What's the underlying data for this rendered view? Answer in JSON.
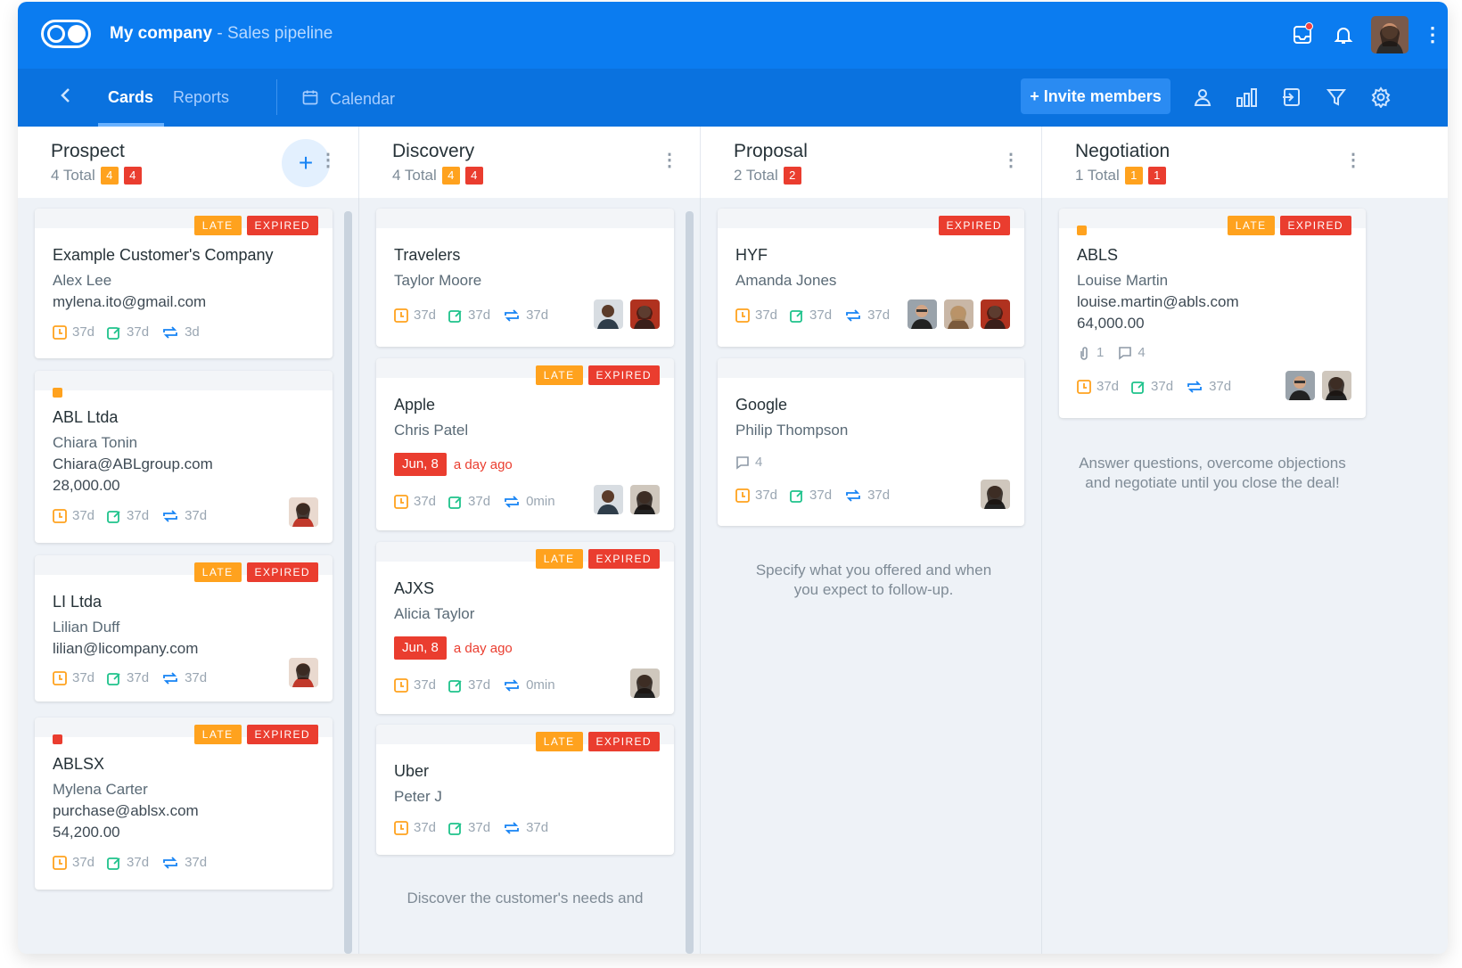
{
  "header": {
    "app": "My company",
    "subtitle": " - Sales pipeline"
  },
  "nav": {
    "tabs": [
      "Cards",
      "Reports"
    ],
    "calendar": "Calendar",
    "invite": "+ Invite members"
  },
  "columns": [
    {
      "name": "Prospect",
      "total": "4 Total",
      "late": "4",
      "expired": "4"
    },
    {
      "name": "Discovery",
      "total": "4 Total",
      "late": "4",
      "expired": "4"
    },
    {
      "name": "Proposal",
      "total": "2 Total",
      "late": "",
      "expired": "2"
    },
    {
      "name": "Negotiation",
      "total": "1 Total",
      "late": "1",
      "expired": "1"
    }
  ],
  "labels": {
    "late": "LATE",
    "expired": "EXPIRED"
  },
  "cards": {
    "p1": {
      "title": "Example Customer's Company",
      "contact": "Alex Lee",
      "email": "mylena.ito@gmail.com",
      "m1": "37d",
      "m2": "37d",
      "m3": "3d"
    },
    "p2": {
      "title": "ABL Ltda",
      "contact": "Chiara Tonin",
      "email": "Chiara@ABLgroup.com",
      "value": "28,000.00",
      "m1": "37d",
      "m2": "37d",
      "m3": "37d"
    },
    "p3": {
      "title": "LI Ltda",
      "contact": "Lilian Duff",
      "email": "lilian@licompany.com",
      "m1": "37d",
      "m2": "37d",
      "m3": "37d"
    },
    "p4": {
      "title": "ABLSX",
      "contact": "Mylena Carter",
      "email": "purchase@ablsx.com",
      "value": "54,200.00",
      "m1": "37d",
      "m2": "37d",
      "m3": "37d"
    },
    "d1": {
      "title": "Travelers",
      "contact": "Taylor Moore",
      "m1": "37d",
      "m2": "37d",
      "m3": "37d"
    },
    "d2": {
      "title": "Apple",
      "contact": "Chris Patel",
      "due": "Jun, 8",
      "ago": "a day ago",
      "m1": "37d",
      "m2": "37d",
      "m3": "0min"
    },
    "d3": {
      "title": "AJXS",
      "contact": "Alicia Taylor",
      "due": "Jun, 8",
      "ago": "a day ago",
      "m1": "37d",
      "m2": "37d",
      "m3": "0min"
    },
    "d4": {
      "title": "Uber",
      "contact": "Peter J",
      "m1": "37d",
      "m2": "37d",
      "m3": "37d"
    },
    "r1": {
      "title": "HYF",
      "contact": "Amanda Jones",
      "m1": "37d",
      "m2": "37d",
      "m3": "37d"
    },
    "r2": {
      "title": "Google",
      "contact": "Philip Thompson",
      "comments": "4",
      "m1": "37d",
      "m2": "37d",
      "m3": "37d"
    },
    "n1": {
      "title": "ABLS",
      "contact": "Louise Martin",
      "email": "louise.martin@abls.com",
      "value": "64,000.00",
      "attachments": "1",
      "comments": "4",
      "m1": "37d",
      "m2": "37d",
      "m3": "37d"
    }
  },
  "hints": {
    "discovery": "Discover the customer's needs and",
    "proposal": "Specify what you offered and when you expect to follow-up.",
    "negotiation": "Answer questions, overcome objections and negotiate until you close the deal!"
  },
  "colors": {
    "primary": "#0b7cf0",
    "late": "#ffa21e",
    "expired": "#ea3d2f",
    "metric_start": "#ffa21e",
    "metric_update": "#1ec28b",
    "metric_cycle": "#1683f4"
  }
}
